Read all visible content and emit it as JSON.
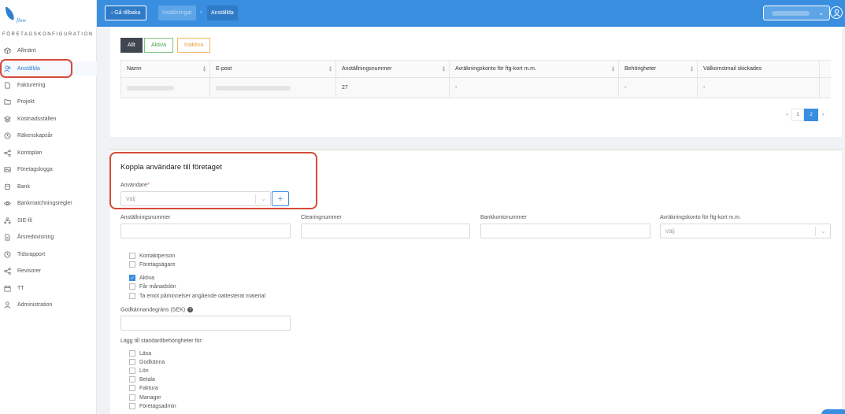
{
  "sidebar": {
    "section_title": "FÖRETAGSKONFIGURATION",
    "items": [
      {
        "label": "Allmänt",
        "icon": "cube-icon"
      },
      {
        "label": "Anställda",
        "icon": "users-icon"
      },
      {
        "label": "Fakturering",
        "icon": "file-icon"
      },
      {
        "label": "Projekt",
        "icon": "folder-icon"
      },
      {
        "label": "Kostnadsställen",
        "icon": "layers-icon"
      },
      {
        "label": "Räkenskapsår",
        "icon": "clock-icon"
      },
      {
        "label": "Kontoplan",
        "icon": "share-icon"
      },
      {
        "label": "Företagslogga",
        "icon": "image-icon"
      },
      {
        "label": "Bank",
        "icon": "database-icon"
      },
      {
        "label": "Bankmatchningsregler",
        "icon": "eye-icon"
      },
      {
        "label": "SIE-fil",
        "icon": "sitemap-icon"
      },
      {
        "label": "Årsredovisning",
        "icon": "document-icon"
      },
      {
        "label": "Tidsrapport",
        "icon": "clock-icon"
      },
      {
        "label": "Revisorer",
        "icon": "share-icon"
      },
      {
        "label": "TT",
        "icon": "calendar-icon"
      },
      {
        "label": "Administration",
        "icon": "person-icon"
      }
    ]
  },
  "header": {
    "back_label": "‹  Gå tillbaka",
    "breadcrumb_parent": "Inställningar",
    "breadcrumb_sep": "›",
    "breadcrumb_current": "Anställda"
  },
  "filters": {
    "all": "Allt",
    "active": "Aktiva",
    "inactive": "Inaktiva"
  },
  "table": {
    "columns": [
      "Namn",
      "E-post",
      "Anställningsnummer",
      "Avräkningskonto för ftg-kort m.m.",
      "Behörigheter",
      "Välkomstmail skickades"
    ],
    "row": {
      "employee_number": "27",
      "account": "-",
      "permissions": "-",
      "welcome": "-"
    }
  },
  "pagination": {
    "prev": "‹",
    "pages": [
      "1",
      "2"
    ],
    "current": "2",
    "next": "›"
  },
  "form": {
    "title": "Koppla användare till företaget",
    "user_label": "Användare",
    "required_mark": "*",
    "user_placeholder": "Välj",
    "add_label": "+",
    "employee_number_label": "Anställningsnummer",
    "clearing_label": "Clearingnummer",
    "bank_account_label": "Bankkontonummer",
    "account_label": "Avräkningskonto för ftg-kort m.m.",
    "account_placeholder": "Välj",
    "checkboxes1": [
      {
        "label": "Kontaktperson",
        "checked": false
      },
      {
        "label": "Företagsägare",
        "checked": false
      }
    ],
    "checkboxes2": [
      {
        "label": "Aktiva",
        "checked": true
      },
      {
        "label": "Får månadslön",
        "checked": false
      },
      {
        "label": "Ta emot påminnelser angående oattesterat material",
        "checked": false
      }
    ],
    "approval_label": "Godkännandegräns (SEK)",
    "help_icon": "?",
    "standard_perms_label": "Lägg till standardbehörigheter för:",
    "perms": [
      "Läsa",
      "Godkänna",
      "Lön",
      "Betala",
      "Faktura",
      "Manager",
      "Företagsadmin"
    ]
  },
  "colors": {
    "primary": "#3a8ee0",
    "highlight": "#d64a3a",
    "success": "#47a447",
    "warning": "#e59d37"
  }
}
